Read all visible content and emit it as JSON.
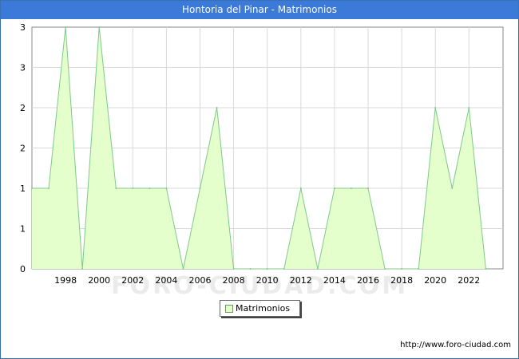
{
  "header": {
    "title": "Hontoria del Pinar - Matrimonios"
  },
  "legend": {
    "label": "Matrimonios"
  },
  "footer": {
    "url": "http://www.foro-ciudad.com"
  },
  "watermark": "FORO-CIUDAD.COM",
  "colors": {
    "title_bg": "#3b7ad9",
    "area_fill": "#e5ffcc",
    "area_line": "#7ec98a",
    "grid": "#d9d9d9"
  },
  "chart_data": {
    "type": "area",
    "title": "Hontoria del Pinar - Matrimonios",
    "x": [
      1996,
      1997,
      1998,
      1999,
      2000,
      2001,
      2002,
      2003,
      2004,
      2005,
      2006,
      2007,
      2008,
      2009,
      2010,
      2011,
      2012,
      2013,
      2014,
      2015,
      2016,
      2017,
      2018,
      2019,
      2020,
      2021,
      2022,
      2023
    ],
    "series": [
      {
        "name": "Matrimonios",
        "values": [
          1,
          1,
          3,
          0,
          3,
          1,
          1,
          1,
          1,
          0,
          1,
          2,
          0,
          0,
          0,
          0,
          1,
          0,
          1,
          1,
          1,
          0,
          0,
          0,
          2,
          1,
          2,
          0
        ]
      }
    ],
    "xticks": [
      1998,
      2000,
      2002,
      2004,
      2006,
      2008,
      2010,
      2012,
      2014,
      2016,
      2018,
      2020,
      2022
    ],
    "ytick_labels": [
      "0",
      "1",
      "1",
      "2",
      "2",
      "3",
      "3"
    ],
    "ylim": [
      0,
      3
    ],
    "grid": true,
    "legend_position": "bottom-center"
  }
}
